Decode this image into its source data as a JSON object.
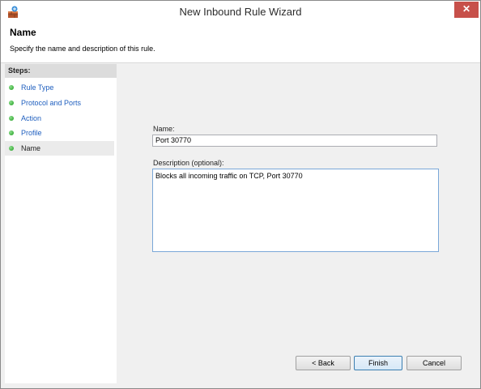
{
  "window": {
    "title": "New Inbound Rule Wizard",
    "close_glyph": "✕",
    "app_icon": "firewall-wizard-icon"
  },
  "header": {
    "title": "Name",
    "subtitle": "Specify the name and description of this rule."
  },
  "sidebar": {
    "heading": "Steps:",
    "items": [
      {
        "label": "Rule Type"
      },
      {
        "label": "Protocol and Ports"
      },
      {
        "label": "Action"
      },
      {
        "label": "Profile"
      },
      {
        "label": "Name"
      }
    ]
  },
  "form": {
    "name_label": "Name:",
    "name_value": "Port 30770",
    "description_label": "Description (optional):",
    "description_value": "Blocks all incoming traffic on TCP, Port 30770"
  },
  "buttons": {
    "back": "< Back",
    "finish": "Finish",
    "cancel": "Cancel"
  },
  "colors": {
    "accent_link": "#1f5fbf",
    "close_button": "#c7504a",
    "step_dot": "#1b9a1b"
  }
}
